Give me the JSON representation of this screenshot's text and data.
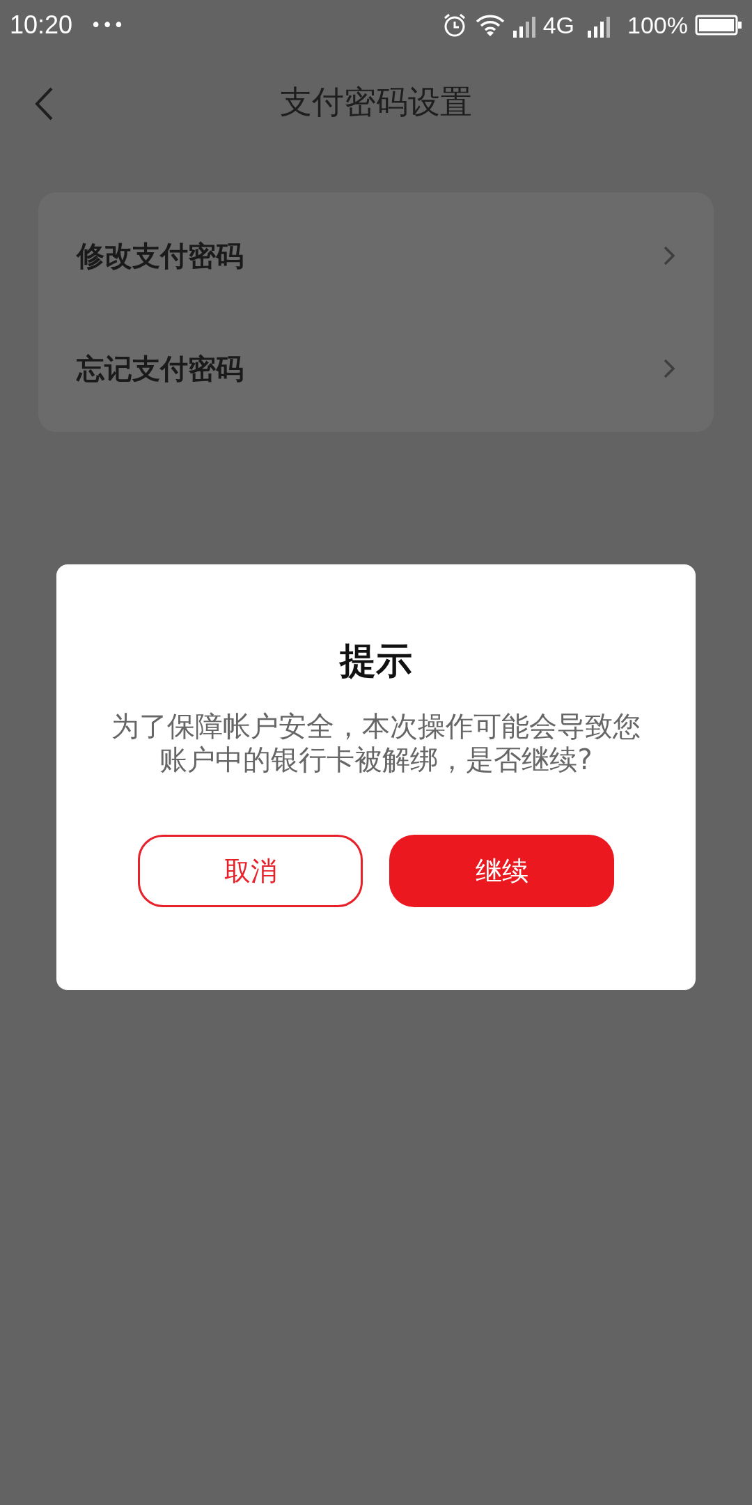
{
  "status_bar": {
    "time": "10:20",
    "dots": "•••",
    "network": "4G",
    "battery": "100%"
  },
  "header": {
    "title": "支付密码设置"
  },
  "menu": [
    {
      "label": "修改支付密码"
    },
    {
      "label": "忘记支付密码"
    }
  ],
  "dialog": {
    "title": "提示",
    "message_lines": [
      "为了保障帐户安全，本次操作可能会导致您",
      "账户中的银行卡被解绑，是否继续?"
    ],
    "buttons": [
      {
        "label": "取消",
        "kind": "outline"
      },
      {
        "label": "继续",
        "kind": "filled"
      }
    ]
  }
}
